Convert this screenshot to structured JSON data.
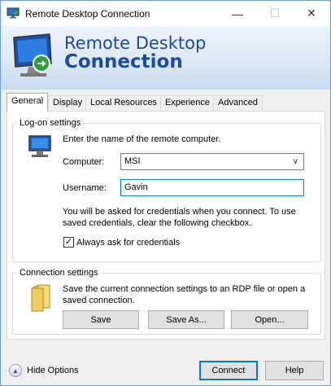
{
  "window": {
    "title": "Remote Desktop Connection"
  },
  "banner": {
    "line1": "Remote Desktop",
    "line2": "Connection"
  },
  "tabs": [
    {
      "label": "General",
      "active": true
    },
    {
      "label": "Display",
      "active": false
    },
    {
      "label": "Local Resources",
      "active": false
    },
    {
      "label": "Experience",
      "active": false
    },
    {
      "label": "Advanced",
      "active": false
    }
  ],
  "logon": {
    "title": "Log-on settings",
    "instruction": "Enter the name of the remote computer.",
    "computer_label": "Computer:",
    "computer_value": "MSI",
    "username_label": "Username:",
    "username_value": "Gavin",
    "credentials_note_line1": "You will be asked for credentials when you connect. To use",
    "credentials_note_line2": "saved credentials, clear the following checkbox.",
    "always_ask_label": "Always ask for credentials",
    "always_ask_checked": true
  },
  "connection": {
    "title": "Connection settings",
    "description_line1": "Save the current connection settings to an RDP file or open a",
    "description_line2": "saved connection.",
    "save_label": "Save",
    "save_as_label": "Save As...",
    "open_label": "Open..."
  },
  "footer": {
    "hide_options_label": "Hide Options",
    "connect_label": "Connect",
    "help_label": "Help"
  },
  "colors": {
    "accent": "#0078d7",
    "banner_text": "#1f4a9a"
  },
  "icons": {
    "title": "monitor-remote-icon",
    "banner": "remote-desktop-monitor-icon",
    "computer": "computer-monitor-icon",
    "folder": "folder-icon",
    "hide_options": "chevron-up-circle-icon"
  }
}
